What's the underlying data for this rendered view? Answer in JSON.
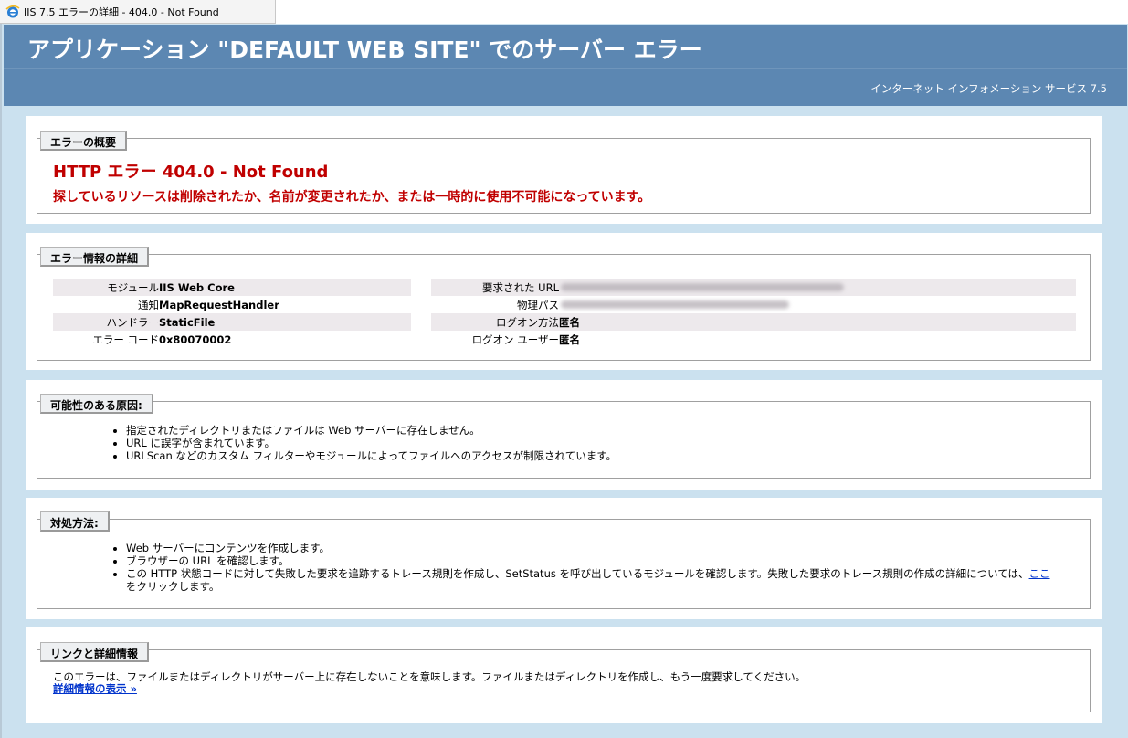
{
  "tab": {
    "title": "IIS 7.5 エラーの詳細 - 404.0 - Not Found",
    "icon": "ie-icon"
  },
  "header": {
    "title": "アプリケーション \"DEFAULT WEB SITE\" でのサーバー エラー",
    "subtitle": "インターネット インフォメーション サービス 7.5"
  },
  "summary": {
    "legend": "エラーの概要",
    "error_title": "HTTP エラー 404.0 - Not Found",
    "error_desc": "探しているリソースは削除されたか、名前が変更されたか、または一時的に使用不可能になっています。"
  },
  "details": {
    "legend": "エラー情報の詳細",
    "left": [
      {
        "label": "モジュール",
        "value": "IIS Web Core"
      },
      {
        "label": "通知",
        "value": "MapRequestHandler"
      },
      {
        "label": "ハンドラー",
        "value": "StaticFile"
      },
      {
        "label": "エラー コード",
        "value": "0x80070002"
      }
    ],
    "right": [
      {
        "label": "要求された URL",
        "value": ""
      },
      {
        "label": "物理パス",
        "value": ""
      },
      {
        "label": "ログオン方法",
        "value": "匿名"
      },
      {
        "label": "ログオン ユーザー",
        "value": "匿名"
      }
    ]
  },
  "causes": {
    "legend": "可能性のある原因:",
    "items": [
      "指定されたディレクトリまたはファイルは Web サーバーに存在しません。",
      "URL に誤字が含まれています。",
      "URLScan などのカスタム フィルターやモジュールによってファイルへのアクセスが制限されています。"
    ]
  },
  "actions": {
    "legend": "対処方法:",
    "items": [
      "Web サーバーにコンテンツを作成します。",
      "ブラウザーの URL を確認します。"
    ],
    "item3_before": "この HTTP 状態コードに対して失敗した要求を追跡するトレース規則を作成し、SetStatus を呼び出しているモジュールを確認します。失敗した要求のトレース規則の作成の詳細については、",
    "item3_link": "ここ",
    "item3_after": "をクリックします。"
  },
  "links": {
    "legend": "リンクと詳細情報",
    "text": "このエラーは、ファイルまたはディレクトリがサーバー上に存在しないことを意味します。ファイルまたはディレクトリを作成し、もう一度要求してください。",
    "more": "詳細情報の表示 »"
  }
}
